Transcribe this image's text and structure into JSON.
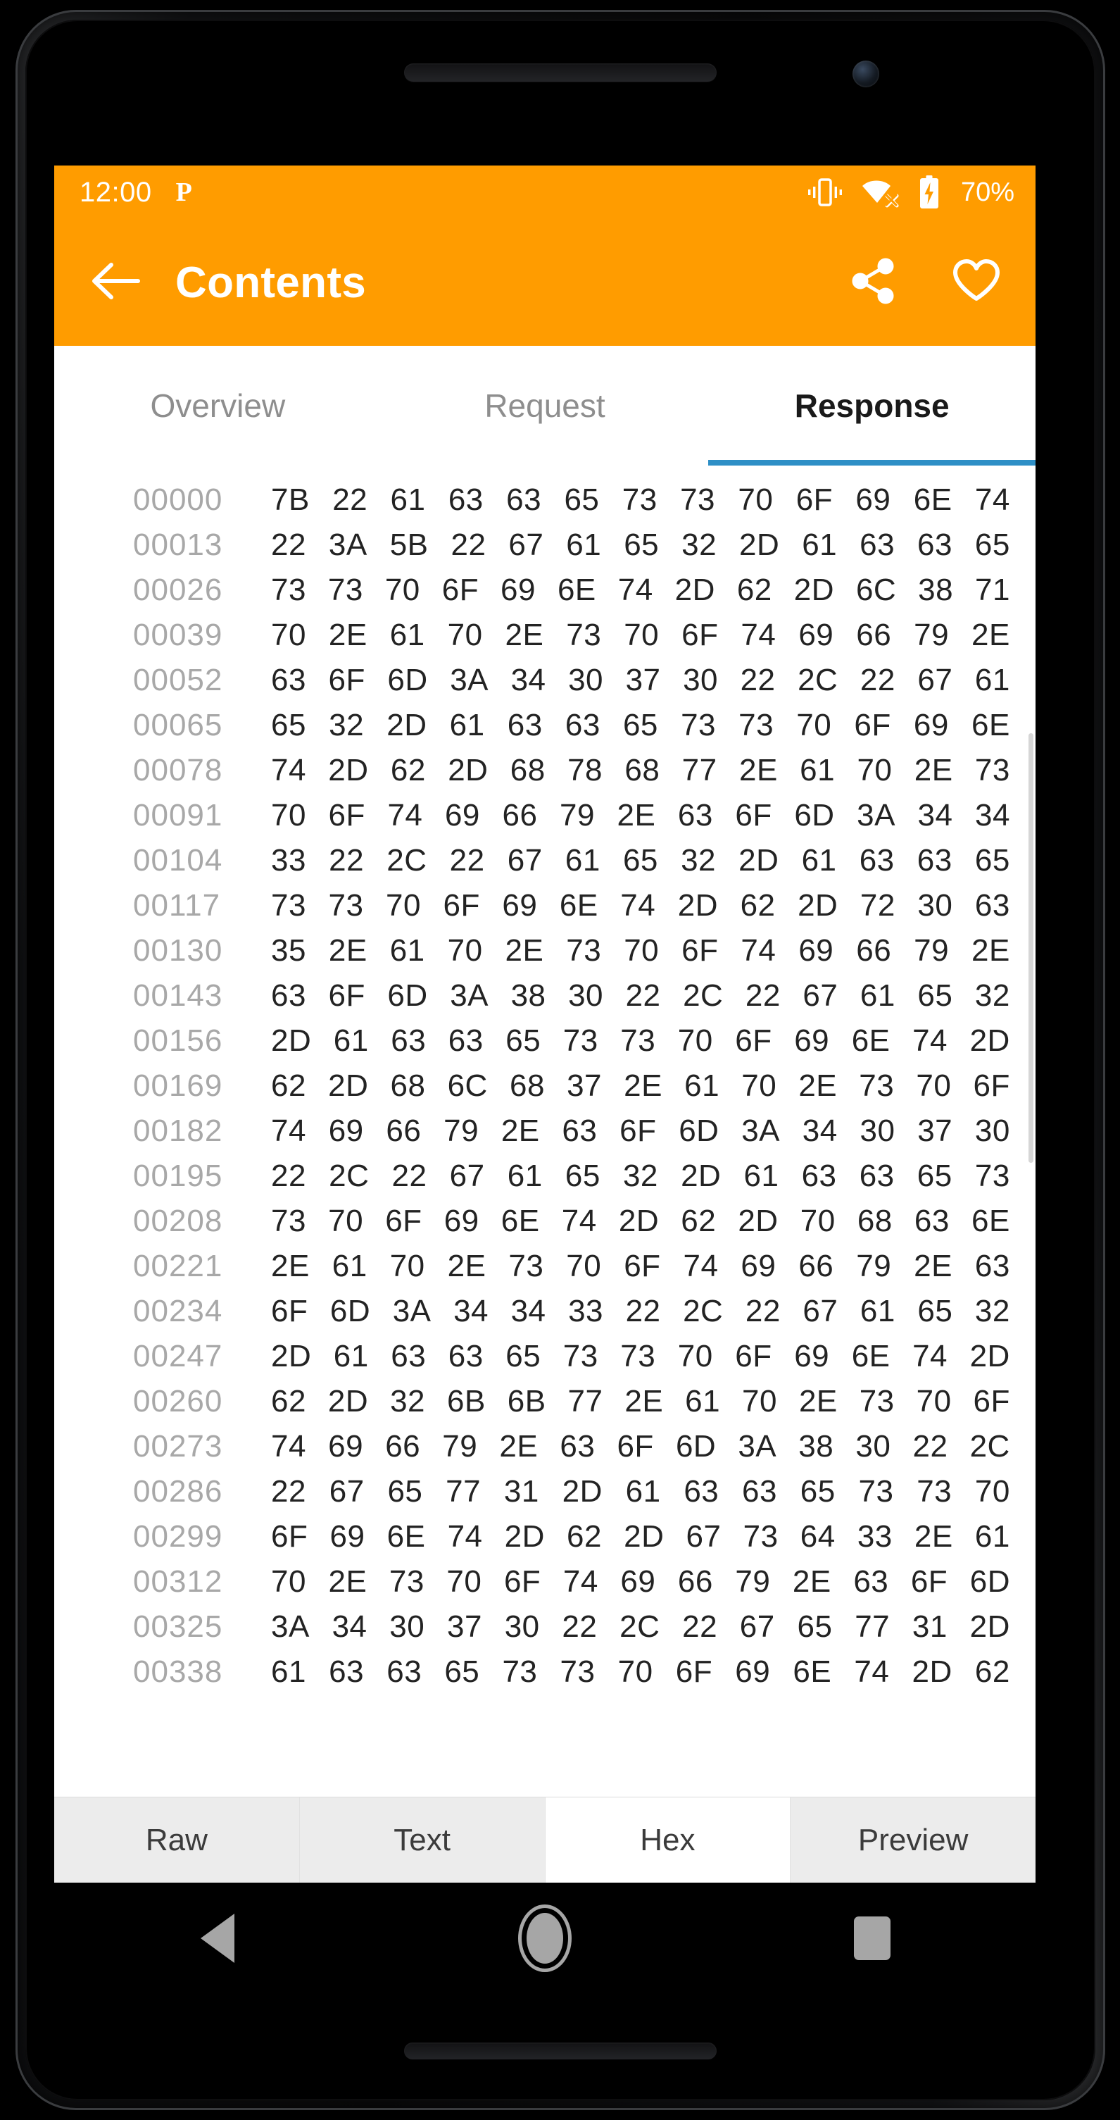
{
  "status_bar": {
    "time": "12:00",
    "p_icon_label": "P",
    "icons": [
      "vibrate-icon",
      "wifi-off-icon",
      "battery-charging-icon"
    ],
    "battery_percent": "70%",
    "background_color": "#FF9C00"
  },
  "app_bar": {
    "back_label": "back-arrow",
    "title": "Contents",
    "actions": [
      {
        "name": "share",
        "label": "share-icon"
      },
      {
        "name": "favorite",
        "label": "heart-icon"
      }
    ]
  },
  "tabs": {
    "items": [
      {
        "label": "Overview",
        "active": false
      },
      {
        "label": "Request",
        "active": false
      },
      {
        "label": "Response",
        "active": true
      }
    ],
    "indicator_color": "#2E8FC6"
  },
  "hex_view": {
    "rows": [
      {
        "offset": "00000",
        "bytes": [
          "7B",
          "22",
          "61",
          "63",
          "63",
          "65",
          "73",
          "73",
          "70",
          "6F",
          "69",
          "6E",
          "74"
        ]
      },
      {
        "offset": "00013",
        "bytes": [
          "22",
          "3A",
          "5B",
          "22",
          "67",
          "61",
          "65",
          "32",
          "2D",
          "61",
          "63",
          "63",
          "65"
        ]
      },
      {
        "offset": "00026",
        "bytes": [
          "73",
          "73",
          "70",
          "6F",
          "69",
          "6E",
          "74",
          "2D",
          "62",
          "2D",
          "6C",
          "38",
          "71"
        ]
      },
      {
        "offset": "00039",
        "bytes": [
          "70",
          "2E",
          "61",
          "70",
          "2E",
          "73",
          "70",
          "6F",
          "74",
          "69",
          "66",
          "79",
          "2E"
        ]
      },
      {
        "offset": "00052",
        "bytes": [
          "63",
          "6F",
          "6D",
          "3A",
          "34",
          "30",
          "37",
          "30",
          "22",
          "2C",
          "22",
          "67",
          "61"
        ]
      },
      {
        "offset": "00065",
        "bytes": [
          "65",
          "32",
          "2D",
          "61",
          "63",
          "63",
          "65",
          "73",
          "73",
          "70",
          "6F",
          "69",
          "6E"
        ]
      },
      {
        "offset": "00078",
        "bytes": [
          "74",
          "2D",
          "62",
          "2D",
          "68",
          "78",
          "68",
          "77",
          "2E",
          "61",
          "70",
          "2E",
          "73"
        ]
      },
      {
        "offset": "00091",
        "bytes": [
          "70",
          "6F",
          "74",
          "69",
          "66",
          "79",
          "2E",
          "63",
          "6F",
          "6D",
          "3A",
          "34",
          "34"
        ]
      },
      {
        "offset": "00104",
        "bytes": [
          "33",
          "22",
          "2C",
          "22",
          "67",
          "61",
          "65",
          "32",
          "2D",
          "61",
          "63",
          "63",
          "65"
        ]
      },
      {
        "offset": "00117",
        "bytes": [
          "73",
          "73",
          "70",
          "6F",
          "69",
          "6E",
          "74",
          "2D",
          "62",
          "2D",
          "72",
          "30",
          "63"
        ]
      },
      {
        "offset": "00130",
        "bytes": [
          "35",
          "2E",
          "61",
          "70",
          "2E",
          "73",
          "70",
          "6F",
          "74",
          "69",
          "66",
          "79",
          "2E"
        ]
      },
      {
        "offset": "00143",
        "bytes": [
          "63",
          "6F",
          "6D",
          "3A",
          "38",
          "30",
          "22",
          "2C",
          "22",
          "67",
          "61",
          "65",
          "32"
        ]
      },
      {
        "offset": "00156",
        "bytes": [
          "2D",
          "61",
          "63",
          "63",
          "65",
          "73",
          "73",
          "70",
          "6F",
          "69",
          "6E",
          "74",
          "2D"
        ]
      },
      {
        "offset": "00169",
        "bytes": [
          "62",
          "2D",
          "68",
          "6C",
          "68",
          "37",
          "2E",
          "61",
          "70",
          "2E",
          "73",
          "70",
          "6F"
        ]
      },
      {
        "offset": "00182",
        "bytes": [
          "74",
          "69",
          "66",
          "79",
          "2E",
          "63",
          "6F",
          "6D",
          "3A",
          "34",
          "30",
          "37",
          "30"
        ]
      },
      {
        "offset": "00195",
        "bytes": [
          "22",
          "2C",
          "22",
          "67",
          "61",
          "65",
          "32",
          "2D",
          "61",
          "63",
          "63",
          "65",
          "73"
        ]
      },
      {
        "offset": "00208",
        "bytes": [
          "73",
          "70",
          "6F",
          "69",
          "6E",
          "74",
          "2D",
          "62",
          "2D",
          "70",
          "68",
          "63",
          "6E"
        ]
      },
      {
        "offset": "00221",
        "bytes": [
          "2E",
          "61",
          "70",
          "2E",
          "73",
          "70",
          "6F",
          "74",
          "69",
          "66",
          "79",
          "2E",
          "63"
        ]
      },
      {
        "offset": "00234",
        "bytes": [
          "6F",
          "6D",
          "3A",
          "34",
          "34",
          "33",
          "22",
          "2C",
          "22",
          "67",
          "61",
          "65",
          "32"
        ]
      },
      {
        "offset": "00247",
        "bytes": [
          "2D",
          "61",
          "63",
          "63",
          "65",
          "73",
          "73",
          "70",
          "6F",
          "69",
          "6E",
          "74",
          "2D"
        ]
      },
      {
        "offset": "00260",
        "bytes": [
          "62",
          "2D",
          "32",
          "6B",
          "6B",
          "77",
          "2E",
          "61",
          "70",
          "2E",
          "73",
          "70",
          "6F"
        ]
      },
      {
        "offset": "00273",
        "bytes": [
          "74",
          "69",
          "66",
          "79",
          "2E",
          "63",
          "6F",
          "6D",
          "3A",
          "38",
          "30",
          "22",
          "2C"
        ]
      },
      {
        "offset": "00286",
        "bytes": [
          "22",
          "67",
          "65",
          "77",
          "31",
          "2D",
          "61",
          "63",
          "63",
          "65",
          "73",
          "73",
          "70"
        ]
      },
      {
        "offset": "00299",
        "bytes": [
          "6F",
          "69",
          "6E",
          "74",
          "2D",
          "62",
          "2D",
          "67",
          "73",
          "64",
          "33",
          "2E",
          "61"
        ]
      },
      {
        "offset": "00312",
        "bytes": [
          "70",
          "2E",
          "73",
          "70",
          "6F",
          "74",
          "69",
          "66",
          "79",
          "2E",
          "63",
          "6F",
          "6D"
        ]
      },
      {
        "offset": "00325",
        "bytes": [
          "3A",
          "34",
          "30",
          "37",
          "30",
          "22",
          "2C",
          "22",
          "67",
          "65",
          "77",
          "31",
          "2D"
        ]
      },
      {
        "offset": "00338",
        "bytes": [
          "61",
          "63",
          "63",
          "65",
          "73",
          "73",
          "70",
          "6F",
          "69",
          "6E",
          "74",
          "2D",
          "62"
        ]
      }
    ]
  },
  "bottom_bar": {
    "items": [
      {
        "label": "Raw",
        "active": false
      },
      {
        "label": "Text",
        "active": false
      },
      {
        "label": "Hex",
        "active": true
      },
      {
        "label": "Preview",
        "active": false
      }
    ]
  },
  "nav_bar": {
    "items": [
      {
        "label": "back-triangle-icon"
      },
      {
        "label": "home-circle-icon"
      },
      {
        "label": "recents-square-icon"
      }
    ]
  }
}
